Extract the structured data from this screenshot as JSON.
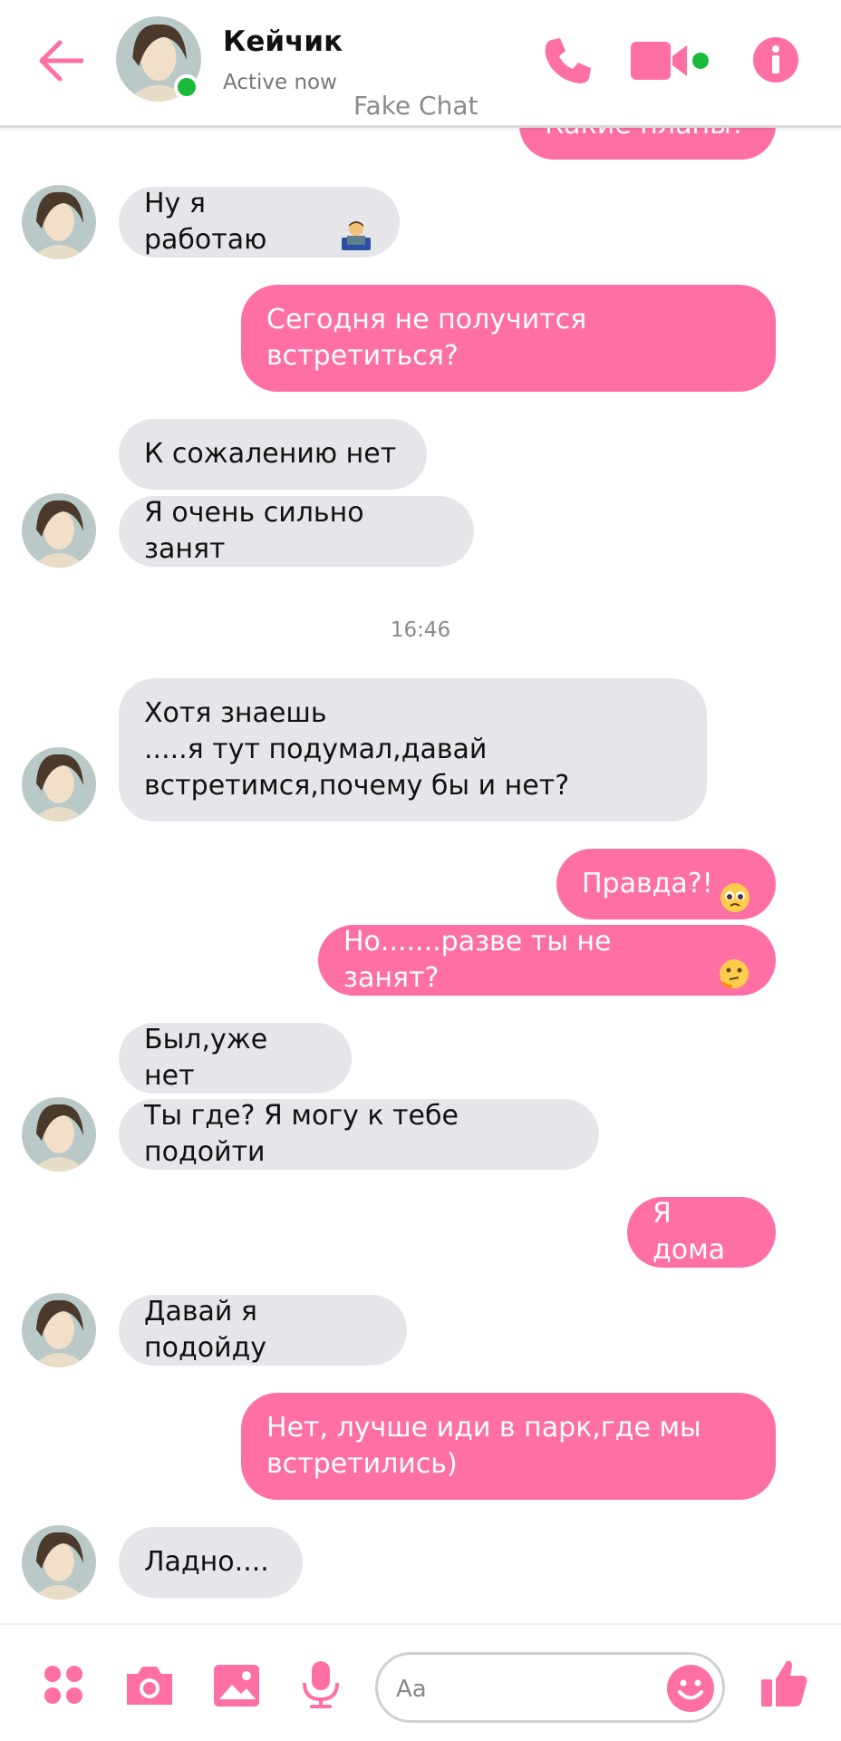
{
  "header": {
    "contact_name": "Кейчик",
    "status": "Active now",
    "watermark": "Fake Chat"
  },
  "messages": [
    {
      "from": "me",
      "text": "Какие планы?"
    },
    {
      "from": "them",
      "text": "Ну я работаю"
    },
    {
      "from": "me",
      "text": "Сегодня не получится\nвстретиться?"
    },
    {
      "from": "them",
      "text": "К сожалению нет"
    },
    {
      "from": "them",
      "text": "Я очень сильно занят"
    },
    {
      "from": "them",
      "text": "Хотя знаешь\n.....я тут подумал,давай\nвстретимся,почему бы и нет?"
    },
    {
      "from": "me",
      "text": "Правда?!"
    },
    {
      "from": "me",
      "text": "Но.......разве ты не занят?"
    },
    {
      "from": "them",
      "text": "Был,уже нет"
    },
    {
      "from": "them",
      "text": "Ты где? Я могу к тебе подойти"
    },
    {
      "from": "me",
      "text": "Я дома"
    },
    {
      "from": "them",
      "text": "Давай я подойду"
    },
    {
      "from": "me",
      "text": "Нет, лучше иди в парк,где мы\nвстретились)"
    },
    {
      "from": "them",
      "text": "Ладно...."
    }
  ],
  "timestamp": "16:46",
  "composer": {
    "placeholder": "Aa"
  },
  "colors": {
    "accent": "#fe6fa5",
    "incoming_bubble": "#e6e5ea",
    "online": "#1bb93c"
  },
  "icons": [
    "back-arrow-icon",
    "phone-icon",
    "video-camera-icon",
    "info-icon",
    "apps-icon",
    "camera-icon",
    "gallery-icon",
    "microphone-icon",
    "smiley-icon",
    "thumbs-up-icon"
  ]
}
